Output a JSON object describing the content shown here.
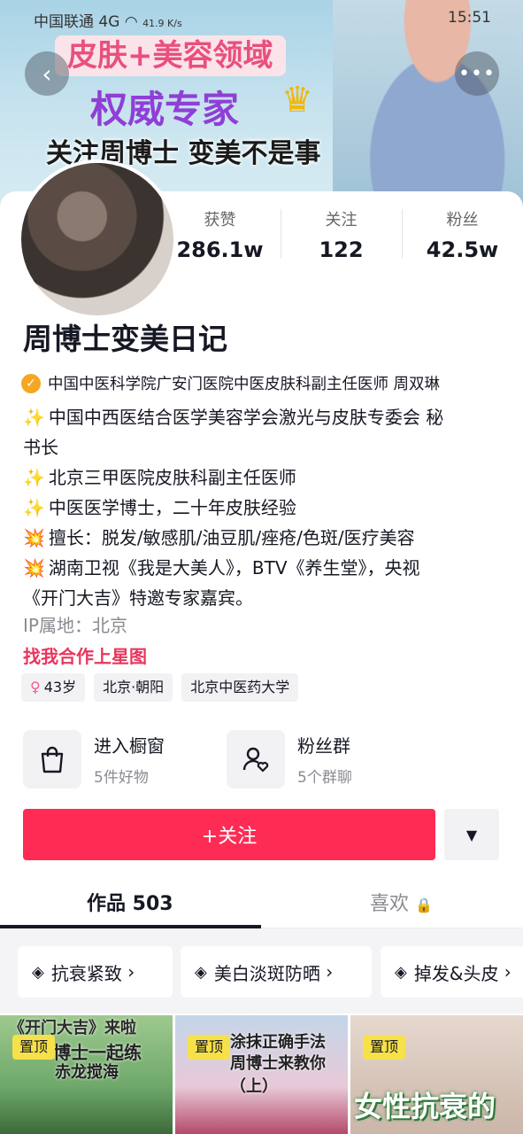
{
  "status_bar": {
    "carrier": "中国联通",
    "net": "4G",
    "speed": "41.9 K/s",
    "time": "15:51"
  },
  "banner": {
    "line1": "皮肤+美容领域",
    "line2": "权威专家",
    "line3": "关注周博士  变美不是事"
  },
  "stats": [
    {
      "label": "获赞",
      "value": "286.1w"
    },
    {
      "label": "关注",
      "value": "122"
    },
    {
      "label": "粉丝",
      "value": "42.5w"
    }
  ],
  "profile": {
    "name": "周博士变美日记",
    "verification": "中国中医科学院广安门医院中医皮肤科副主任医师 周双琳",
    "bio": [
      {
        "emoji": "✨",
        "text": "中国中西医结合医学美容学会激光与皮肤专委会 秘"
      },
      {
        "emoji": "",
        "text": "书长"
      },
      {
        "emoji": "✨",
        "text": "北京三甲医院皮肤科副主任医师"
      },
      {
        "emoji": "✨",
        "text": "中医医学博士，二十年皮肤经验"
      },
      {
        "emoji": "💥",
        "text": "擅长：脱发/敏感肌/油豆肌/痤疮/色斑/医疗美容"
      },
      {
        "emoji": "💥",
        "text": "湖南卫视《我是大美人》，BTV《养生堂》，央视"
      },
      {
        "emoji": "",
        "text": "《开门大吉》特邀专家嘉宾。"
      }
    ],
    "ip": "IP属地：北京",
    "cooperation": "找我合作上星图",
    "tags": {
      "age": "43岁",
      "location": "北京·朝阳",
      "school": "北京中医药大学"
    }
  },
  "shortcuts": {
    "shop_title": "进入橱窗",
    "shop_sub": "5件好物",
    "fans_title": "粉丝群",
    "fans_sub": "5个群聊"
  },
  "actions": {
    "follow": "+关注"
  },
  "tabs": {
    "works": "作品 503",
    "likes": "喜欢"
  },
  "collections": [
    {
      "label": "抗衰紧致"
    },
    {
      "label": "美白淡斑防晒"
    },
    {
      "label": "掉发&头皮"
    }
  ],
  "videos": [
    {
      "pin": "置顶",
      "cap1": "《开门大吉》来啦",
      "cap2": "博士一起练",
      "cap3": "赤龙搅海"
    },
    {
      "pin": "置顶",
      "cap1": "涂抹正确手法",
      "cap2": "周博士来教你（上）"
    },
    {
      "pin": "置顶",
      "cap1": "女性抗衰的"
    }
  ],
  "colors": {
    "primary": "#fe2c55",
    "link": "#e8365d",
    "verify": "#f5a623",
    "pin": "#f7e14a"
  }
}
